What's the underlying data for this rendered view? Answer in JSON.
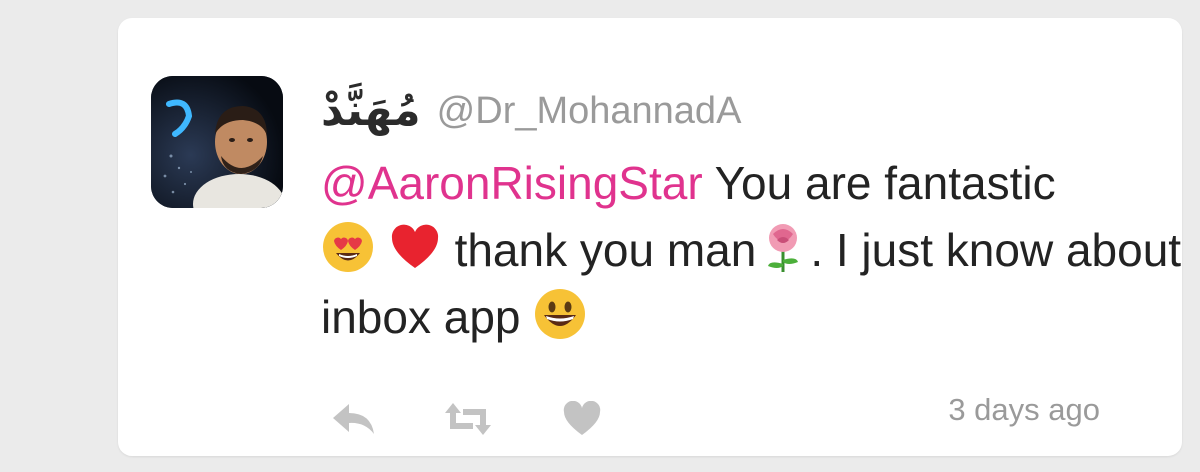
{
  "tweet": {
    "display_name": "مُهَنَّدْ",
    "handle": "@Dr_MohannadA",
    "text": {
      "mention": "@AaronRisingStar",
      "part1": " You are fantastic",
      "part2": " thank you man",
      "part3": ". I just know about inbox app"
    },
    "timestamp": "3 days ago"
  },
  "icons": {
    "avatar": "profile-photo",
    "emoji_1": "heart-eyes-face",
    "emoji_2": "red-heart",
    "emoji_3": "rose",
    "emoji_4": "grinning-face",
    "reply": "reply-arrow",
    "retweet": "retweet-arrows",
    "like": "heart"
  },
  "colors": {
    "mention": "#e0338e",
    "text": "#232323",
    "muted": "#9a9a9a",
    "icon": "#c3c3c3",
    "background": "#ebebeb",
    "card": "#ffffff"
  }
}
